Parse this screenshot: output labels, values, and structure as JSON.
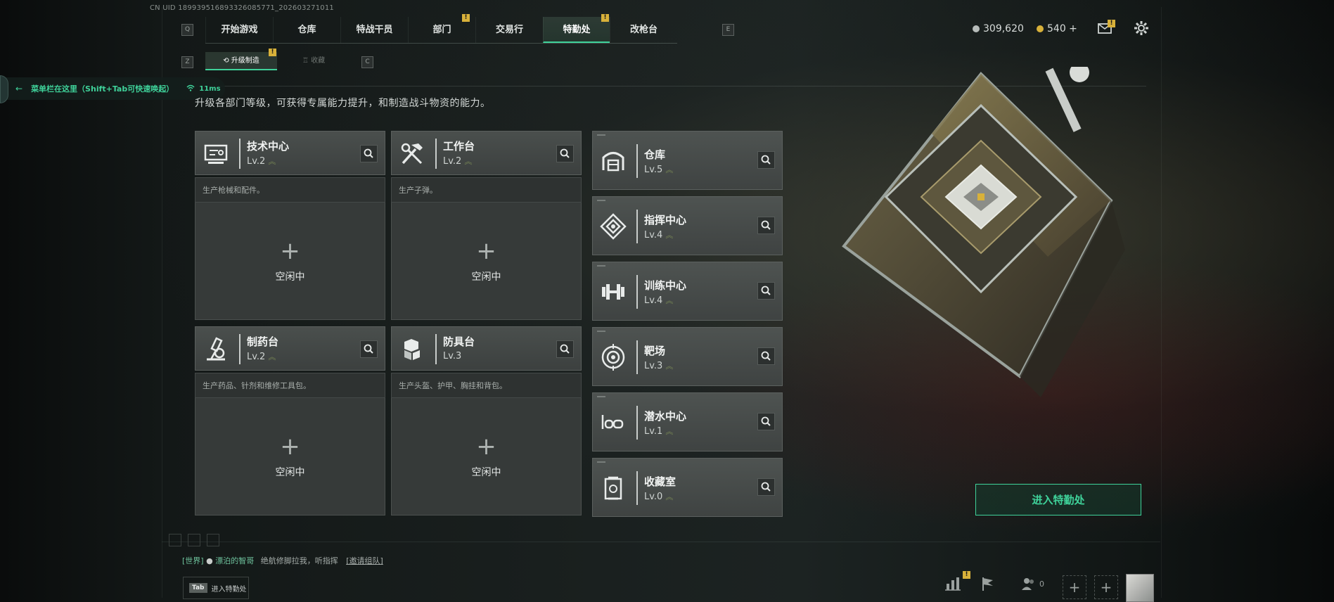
{
  "header": {
    "uid": "CN UID 1899395168933260857​71_202603271011"
  },
  "nav": {
    "left_key": "Q",
    "right_key": "E",
    "items": [
      {
        "label": "开始游戏",
        "badge": ""
      },
      {
        "label": "仓库",
        "badge": ""
      },
      {
        "label": "特战干员",
        "badge": ""
      },
      {
        "label": "部门",
        "badge": "!"
      },
      {
        "label": "交易行",
        "badge": ""
      },
      {
        "label": "特勤处",
        "badge": "!"
      },
      {
        "label": "改枪台",
        "badge": ""
      }
    ],
    "active_index": 5
  },
  "subnav": {
    "left_key": "Z",
    "right_key": "C",
    "upgrade_label": "升级制造",
    "upgrade_badge": "!",
    "collection_label": "收藏"
  },
  "menubar": {
    "text": "菜单栏在这里（Shift+Tab可快速唤起）",
    "latency": "11ms"
  },
  "description": "升级各部门等级，可获得专属能力提升，和制造战斗物资的能力。",
  "workstations": [
    {
      "name": "技术中心",
      "level": "Lv.2",
      "desc": "生产枪械和配件。",
      "status": "空闲中",
      "icon": "tech-center-icon"
    },
    {
      "name": "工作台",
      "level": "Lv.2",
      "desc": "生产子弹。",
      "status": "空闲中",
      "icon": "workbench-icon"
    },
    {
      "name": "制药台",
      "level": "Lv.2",
      "desc": "生产药品、针剂和维修工具包。",
      "status": "空闲中",
      "icon": "pharmacy-icon"
    },
    {
      "name": "防具台",
      "level": "Lv.3",
      "desc": "生产头盔、护甲、胸挂和背包。",
      "status": "空闲中",
      "icon": "armor-bench-icon"
    }
  ],
  "departments": [
    {
      "name": "仓库",
      "level": "Lv.5",
      "icon": "warehouse-icon"
    },
    {
      "name": "指挥中心",
      "level": "Lv.4",
      "icon": "command-center-icon"
    },
    {
      "name": "训练中心",
      "level": "Lv.4",
      "icon": "training-center-icon"
    },
    {
      "name": "靶场",
      "level": "Lv.3",
      "icon": "shooting-range-icon"
    },
    {
      "name": "潜水中心",
      "level": "Lv.1",
      "icon": "diving-center-icon"
    },
    {
      "name": "收藏室",
      "level": "Lv.0",
      "icon": "collection-room-icon"
    }
  ],
  "stats": {
    "silver": "309,620",
    "gold": "540 +",
    "mail_badge": "!"
  },
  "enter_button": "进入特勤处",
  "chat": {
    "channel": "[世界]",
    "user": "漂泊的智哥",
    "message": "绝航修脚拉我，听指挥",
    "link": "[邀请组队]"
  },
  "tab_hint": {
    "key": "Tab",
    "label": "进入特勤处"
  },
  "bottom_bar": {
    "friends_count": "0",
    "stats_badge": "!"
  },
  "colors": {
    "accent": "#3fd29a",
    "badge": "#d8b13a"
  }
}
